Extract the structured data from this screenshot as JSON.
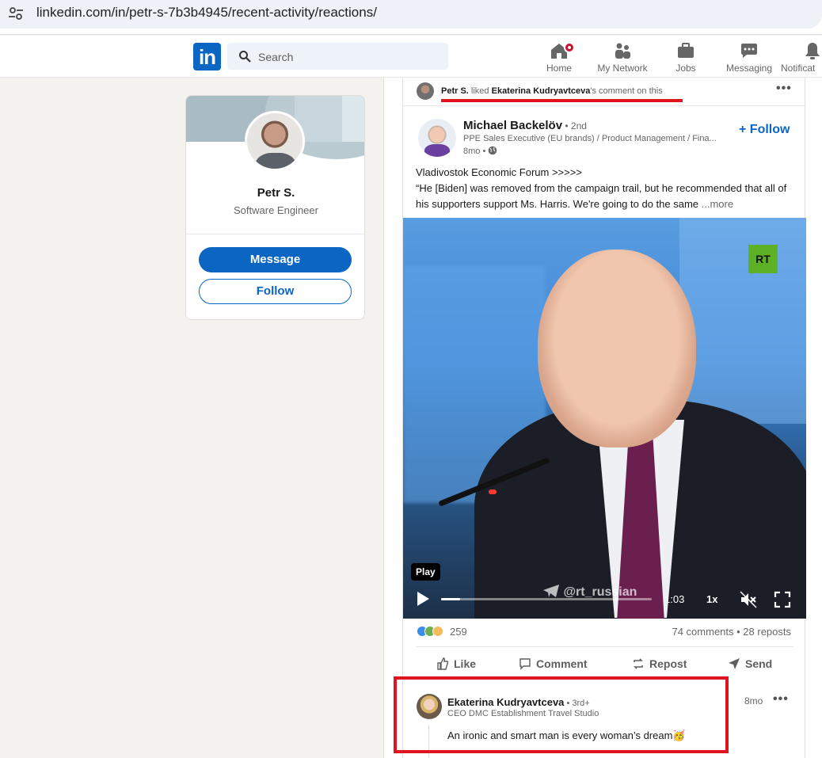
{
  "browser": {
    "url": "linkedin.com/in/petr-s-7b3b4945/recent-activity/reactions/"
  },
  "nav": {
    "logo": "in",
    "search_placeholder": "Search",
    "items": [
      {
        "label": "Home",
        "icon": "home-icon"
      },
      {
        "label": "My Network",
        "icon": "network-icon"
      },
      {
        "label": "Jobs",
        "icon": "briefcase-icon"
      },
      {
        "label": "Messaging",
        "icon": "messaging-icon"
      },
      {
        "label": "Notificat",
        "icon": "bell-icon"
      }
    ]
  },
  "profile": {
    "name": "Petr S.",
    "title": "Software Engineer",
    "message_label": "Message",
    "follow_label": "Follow"
  },
  "post": {
    "activity": {
      "actor": "Petr S.",
      "verb": " liked ",
      "target": "Ekaterina Kudryavtceva",
      "suffix": "'s comment on this"
    },
    "author": {
      "name": "Michael Backelöv",
      "degree": " • 2nd",
      "headline": "PPE Sales Executive (EU brands) / Product Management / Fina...",
      "time": "8mo •",
      "follow_label": "+ Follow"
    },
    "text_line1": "Vladivostok Economic Forum >>>>>",
    "text_line2": "“He [Biden] was removed from the campaign trail, but he recommended that all of his supporters support Ms. Harris. We're going to do the same",
    "more_label": "...more",
    "video": {
      "channel_logo": "RT",
      "play_label": "Play",
      "watermark": "@rt_russian",
      "time": "1:03",
      "speed": "1x",
      "progress": 0.09
    },
    "reactions_count": "259",
    "counts": "74 comments • 28 reposts",
    "actions": [
      "Like",
      "Comment",
      "Repost",
      "Send"
    ]
  },
  "comment": {
    "name": "Ekaterina Kudryavtceva",
    "degree": " • 3rd+",
    "headline": "CEO DMC Establishment Travel Studio",
    "time": "8mo",
    "text": "An ironic and smart man is every woman’s dream🥳"
  },
  "colors": {
    "brand": "#0a66c2",
    "annotation_red": "#e0141f",
    "notification": "#cb112d"
  }
}
